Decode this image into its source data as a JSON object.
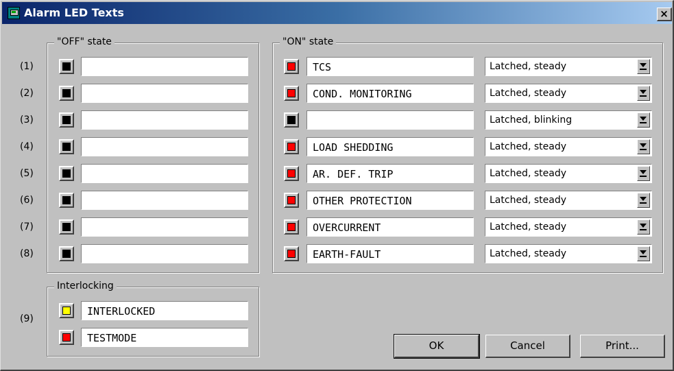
{
  "window": {
    "title": "Alarm LED Texts",
    "close_label": "×"
  },
  "colors": {
    "led_off": "#000000",
    "led_red": "#ff0000",
    "led_yellow": "#ffff00"
  },
  "off_group": {
    "legend": "\"OFF\" state",
    "rows": [
      {
        "num": "(1)",
        "led": "black",
        "text": ""
      },
      {
        "num": "(2)",
        "led": "black",
        "text": ""
      },
      {
        "num": "(3)",
        "led": "black",
        "text": ""
      },
      {
        "num": "(4)",
        "led": "black",
        "text": ""
      },
      {
        "num": "(5)",
        "led": "black",
        "text": ""
      },
      {
        "num": "(6)",
        "led": "black",
        "text": ""
      },
      {
        "num": "(7)",
        "led": "black",
        "text": ""
      },
      {
        "num": "(8)",
        "led": "black",
        "text": ""
      }
    ]
  },
  "on_group": {
    "legend": "\"ON\" state",
    "rows": [
      {
        "led": "red",
        "text": "TCS",
        "mode": "Latched, steady"
      },
      {
        "led": "red",
        "text": "COND. MONITORING",
        "mode": "Latched, steady"
      },
      {
        "led": "black",
        "text": "",
        "mode": "Latched, blinking"
      },
      {
        "led": "red",
        "text": "LOAD SHEDDING",
        "mode": "Latched, steady"
      },
      {
        "led": "red",
        "text": "AR. DEF. TRIP",
        "mode": "Latched, steady"
      },
      {
        "led": "red",
        "text": "OTHER PROTECTION",
        "mode": "Latched, steady"
      },
      {
        "led": "red",
        "text": "OVERCURRENT",
        "mode": "Latched, steady"
      },
      {
        "led": "red",
        "text": "EARTH-FAULT",
        "mode": "Latched, steady"
      }
    ]
  },
  "interlock_group": {
    "legend": "Interlocking",
    "num": "(9)",
    "rows": [
      {
        "led": "yellow",
        "text": "INTERLOCKED"
      },
      {
        "led": "red",
        "text": "TESTMODE"
      }
    ]
  },
  "buttons": {
    "ok": "OK",
    "cancel": "Cancel",
    "print": "Print..."
  }
}
